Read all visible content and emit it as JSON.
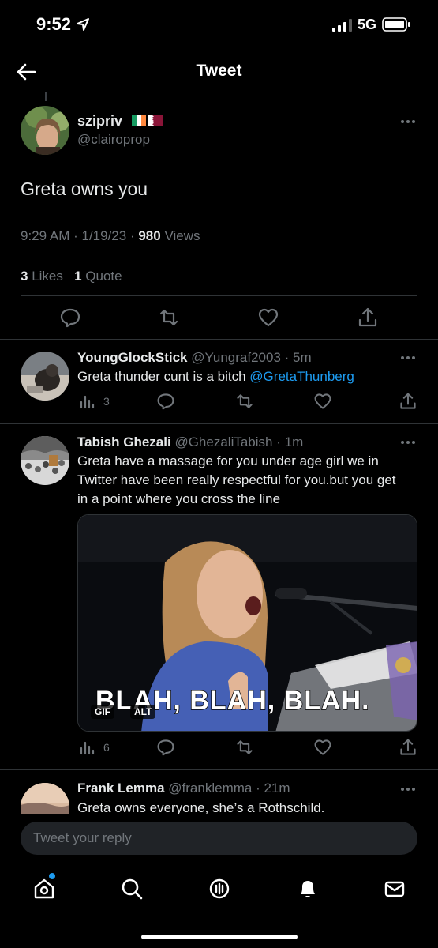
{
  "status": {
    "time": "9:52",
    "network": "5G"
  },
  "header": {
    "title": "Tweet"
  },
  "main_tweet": {
    "display_name": "szipriv",
    "handle": "@clairoprop",
    "text": "Greta owns you",
    "time": "9:29 AM",
    "date": "1/19/23",
    "views_count": "980",
    "views_label": "Views",
    "likes_count": "3",
    "likes_label": "Likes",
    "quotes_count": "1",
    "quotes_label": "Quote"
  },
  "replies": [
    {
      "display_name": "YoungGlockStick",
      "handle": "@Yungraf2003",
      "age": "5m",
      "text": "Greta thunder cunt is a bitch",
      "mention": "@GretaThunberg",
      "views": "3"
    },
    {
      "display_name": "Tabish Ghezali",
      "handle": "@GhezaliTabish",
      "age": "1m",
      "text": "Greta have a massage for you under age girl we in Twitter have been really respectful for you.but you get in a point where you cross the line",
      "media": {
        "caption": "BLAH, BLAH, BLAH.",
        "gif_badge": "GIF",
        "alt_badge": "ALT"
      },
      "views": "6"
    },
    {
      "display_name": "Frank Lemma",
      "handle": "@franklemma",
      "age": "21m",
      "text": "Greta owns everyone, she’s a Rothschild."
    }
  ],
  "compose": {
    "placeholder": "Tweet your reply"
  },
  "tabbar": {
    "items": [
      "home-icon",
      "search-icon",
      "spaces-icon",
      "notifications-icon",
      "messages-icon"
    ]
  },
  "colors": {
    "accent": "#1d9bf0",
    "background": "#000000",
    "muted": "#71767b",
    "divider": "#2f3336"
  }
}
